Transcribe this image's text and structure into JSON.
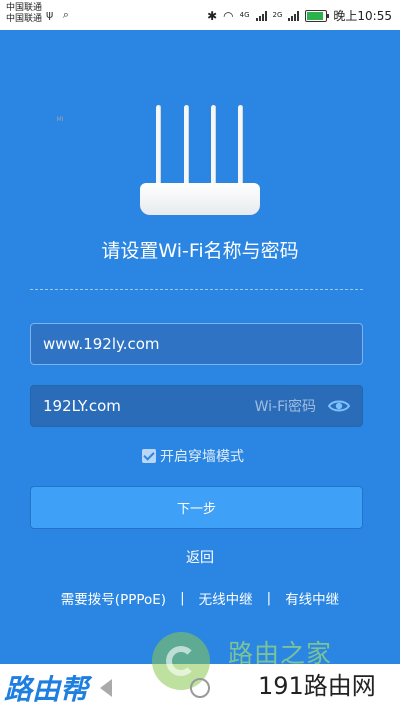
{
  "status_bar": {
    "carrier_1": "中国联通",
    "carrier_2": "中国联通",
    "net_1": "4G",
    "net_2": "2G",
    "time": "晚上10:55"
  },
  "router": {
    "logo": "MI"
  },
  "page": {
    "title": "请设置Wi-Fi名称与密码"
  },
  "form": {
    "ssid_value": "www.192ly.com",
    "password_value": "192LY.com",
    "password_label": "Wi-Fi密码",
    "wall_mode_label": "开启穿墙模式",
    "wall_mode_checked": true,
    "next_label": "下一步",
    "back_label": "返回"
  },
  "modes": [
    "需要拨号(PPPoE)",
    "无线中继",
    "有线中继"
  ],
  "watermarks": {
    "left": "路由帮",
    "center": "路由之家",
    "right": "191路由网"
  },
  "colors": {
    "background": "#2a86e2",
    "button": "#3fa0f8"
  }
}
